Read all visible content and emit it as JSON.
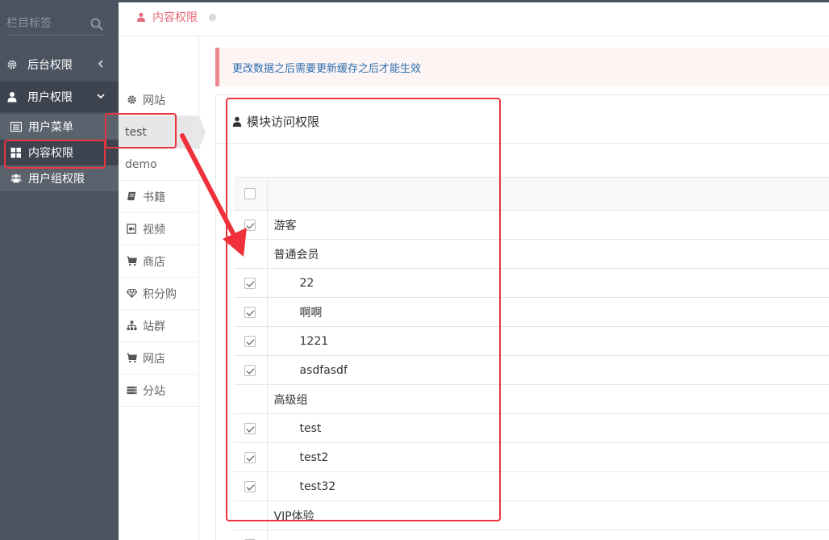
{
  "sidebar": {
    "search": {
      "placeholder": "栏目标签"
    },
    "items": [
      {
        "label": "后台权限",
        "icon": "gear-icon"
      },
      {
        "label": "用户权限",
        "icon": "user-icon"
      }
    ],
    "subitems": [
      {
        "label": "用户菜单",
        "icon": "list-icon"
      },
      {
        "label": "内容权限",
        "icon": "grid-icon"
      },
      {
        "label": "用户组权限",
        "icon": "users-icon"
      }
    ]
  },
  "topbar": {
    "tab_label": "内容权限",
    "tab_icon": "user-icon"
  },
  "subnav": {
    "items": [
      {
        "label": "网站",
        "icon": "gear-icon"
      },
      {
        "label": "test",
        "icon": ""
      },
      {
        "label": "demo",
        "icon": ""
      },
      {
        "label": "书籍",
        "icon": "book-icon"
      },
      {
        "label": "视频",
        "icon": "video-icon"
      },
      {
        "label": "商店",
        "icon": "cart-icon"
      },
      {
        "label": "积分购",
        "icon": "diamond-icon"
      },
      {
        "label": "站群",
        "icon": "sitemap-icon"
      },
      {
        "label": "网店",
        "icon": "cart-icon"
      },
      {
        "label": "分站",
        "icon": "server-icon"
      }
    ],
    "active": "test"
  },
  "notice": {
    "text": "更改数据之后需要更新缓存之后才能生效"
  },
  "panel": {
    "title": "模块访问权限",
    "title_icon": "user-icon",
    "rows": [
      {
        "label": "游客",
        "checked": true,
        "level": 0
      },
      {
        "label": "普通会员",
        "checked": null,
        "level": 0
      },
      {
        "label": "22",
        "checked": true,
        "level": 1
      },
      {
        "label": "啊啊",
        "checked": true,
        "level": 1
      },
      {
        "label": "1221",
        "checked": true,
        "level": 1
      },
      {
        "label": "asdfasdf",
        "checked": true,
        "level": 1
      },
      {
        "label": "高级组",
        "checked": null,
        "level": 0
      },
      {
        "label": "test",
        "checked": true,
        "level": 1
      },
      {
        "label": "test2",
        "checked": true,
        "level": 1
      },
      {
        "label": "test32",
        "checked": true,
        "level": 1
      },
      {
        "label": "VIP体验",
        "checked": null,
        "level": 0
      },
      {
        "label": "",
        "checked": false,
        "level": 1
      }
    ]
  },
  "colors": {
    "sidebar_bg": "#4b5360",
    "accent_pink": "#e66a77",
    "annotation_red": "#e8343f",
    "notice_text": "#2c6fb0"
  }
}
